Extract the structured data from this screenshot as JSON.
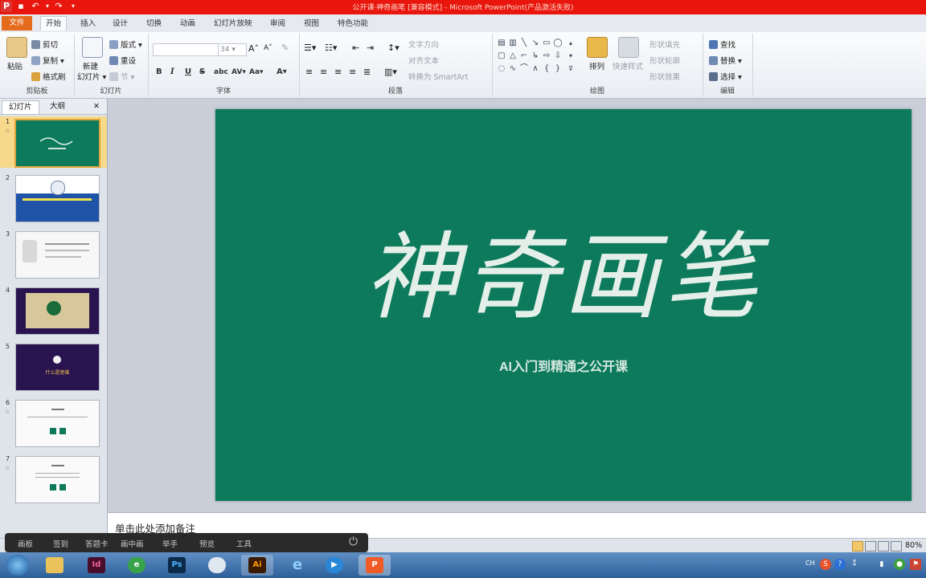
{
  "titlebar": {
    "title": "公开课·神奇画笔 [兼容模式] - Microsoft PowerPoint(产品激活失败)"
  },
  "tabs": [
    "文件",
    "开始",
    "插入",
    "设计",
    "切换",
    "动画",
    "幻灯片放映",
    "审阅",
    "视图",
    "特色功能"
  ],
  "ribbon": {
    "clipboard": {
      "paste": "粘贴",
      "cut": "剪切",
      "copy": "复制",
      "format_painter": "格式刷",
      "label": "剪贴板"
    },
    "slides": {
      "new_slide_1": "新建",
      "new_slide_2": "幻灯片",
      "layout": "版式",
      "reset": "重设",
      "section": "节",
      "label": "幻灯片"
    },
    "font": {
      "size": "34",
      "label": "字体",
      "bold": "B",
      "italic": "I",
      "underline": "U",
      "strike": "S",
      "shadow": "abc"
    },
    "paragraph": {
      "text_direction": "文字方向",
      "align_text": "对齐文本",
      "smartart": "转换为 SmartArt",
      "label": "段落"
    },
    "drawing": {
      "arrange": "排列",
      "quick_styles": "快速样式",
      "shape_fill": "形状填充",
      "shape_outline": "形状轮廓",
      "shape_effects": "形状效果",
      "label": "绘图"
    },
    "editing": {
      "find": "查找",
      "replace": "替换",
      "select": "选择",
      "label": "编辑"
    }
  },
  "leftpane": {
    "tab_slides": "幻灯片",
    "tab_outline": "大纲",
    "close": "✕",
    "thumbnails": [
      {
        "num": "1",
        "star": "☆"
      },
      {
        "num": "2",
        "star": ""
      },
      {
        "num": "3",
        "star": ""
      },
      {
        "num": "4",
        "star": ""
      },
      {
        "num": "5",
        "star": ""
      },
      {
        "num": "6",
        "star": "☆"
      },
      {
        "num": "7",
        "star": "☆"
      }
    ],
    "thumb5_text": "什么是思维"
  },
  "slide": {
    "title": "神奇画笔",
    "subtitle": "AI入门到精通之公开课",
    "bg_color": "#0d7a5c"
  },
  "notes": {
    "placeholder": "单击此处添加备注"
  },
  "overlay": {
    "items": [
      "画板",
      "签到",
      "答题卡",
      "画中画",
      "举手",
      "预览",
      "工具"
    ]
  },
  "statusbar": {
    "zoom": "80%"
  },
  "taskbar": {
    "apps": [
      "Id",
      "e",
      "Ps",
      "",
      "Ai",
      "e",
      "▶",
      "P"
    ],
    "tray_text": "CH"
  }
}
